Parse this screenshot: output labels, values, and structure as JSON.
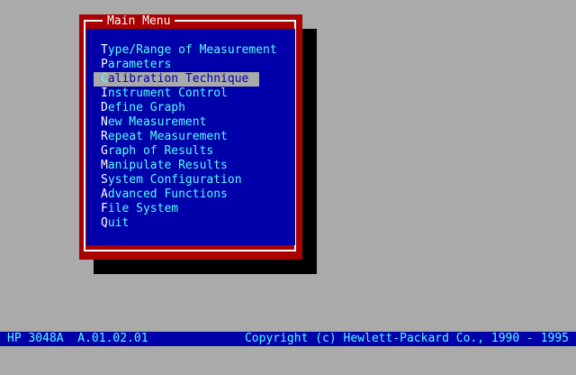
{
  "menu": {
    "title": "Main Menu",
    "selected_index": 2,
    "items": [
      {
        "hotkey": "T",
        "rest": "ype/Range of Measurement"
      },
      {
        "hotkey": "P",
        "rest": "arameters"
      },
      {
        "hotkey": "C",
        "rest": "alibration Technique"
      },
      {
        "hotkey": "I",
        "rest": "nstrument Control"
      },
      {
        "hotkey": "D",
        "rest": "efine Graph"
      },
      {
        "hotkey": "N",
        "rest": "ew Measurement"
      },
      {
        "hotkey": "R",
        "rest": "epeat Measurement"
      },
      {
        "hotkey": "G",
        "rest": "raph of Results"
      },
      {
        "hotkey": "M",
        "rest": "anipulate Results"
      },
      {
        "hotkey": "S",
        "rest": "ystem Configuration"
      },
      {
        "hotkey": "A",
        "rest": "dvanced Functions"
      },
      {
        "hotkey": "F",
        "rest": "ile System"
      },
      {
        "hotkey": "Q",
        "rest": "uit"
      }
    ]
  },
  "status": {
    "left": "HP 3048A  A.01.02.01",
    "right": "Copyright (c) Hewlett-Packard Co., 1990 - 1995"
  },
  "colors": {
    "desktop": "#aaaaaa",
    "window_border": "#aa0000",
    "menu_bg": "#0000aa",
    "item_text": "#55ffff",
    "hotkey_text": "#ffffff",
    "selection_bg": "#aaaaaa"
  }
}
